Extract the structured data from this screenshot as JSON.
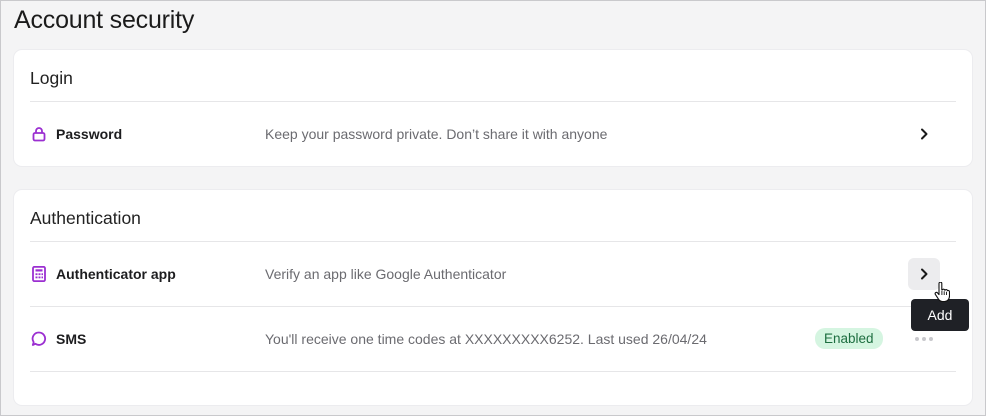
{
  "page": {
    "title": "Account security"
  },
  "login": {
    "title": "Login",
    "rows": [
      {
        "icon": "lock-icon",
        "label": "Password",
        "description": "Keep your password private. Don’t share it with anyone"
      }
    ]
  },
  "authentication": {
    "title": "Authentication",
    "rows": [
      {
        "icon": "calculator-icon",
        "label": "Authenticator app",
        "description": "Verify an app like Google Authenticator"
      },
      {
        "icon": "chat-bubble-icon",
        "label": "SMS",
        "description": "You'll receive one time codes at XXXXXXXXX6252. Last used 26/04/24",
        "status": "Enabled"
      }
    ]
  },
  "tooltip": {
    "text": "Add"
  },
  "colors": {
    "accent": "#9b2fd1",
    "badge_bg": "#d5f5e1",
    "badge_text": "#1d6e40",
    "tooltip_bg": "#1f2126"
  }
}
